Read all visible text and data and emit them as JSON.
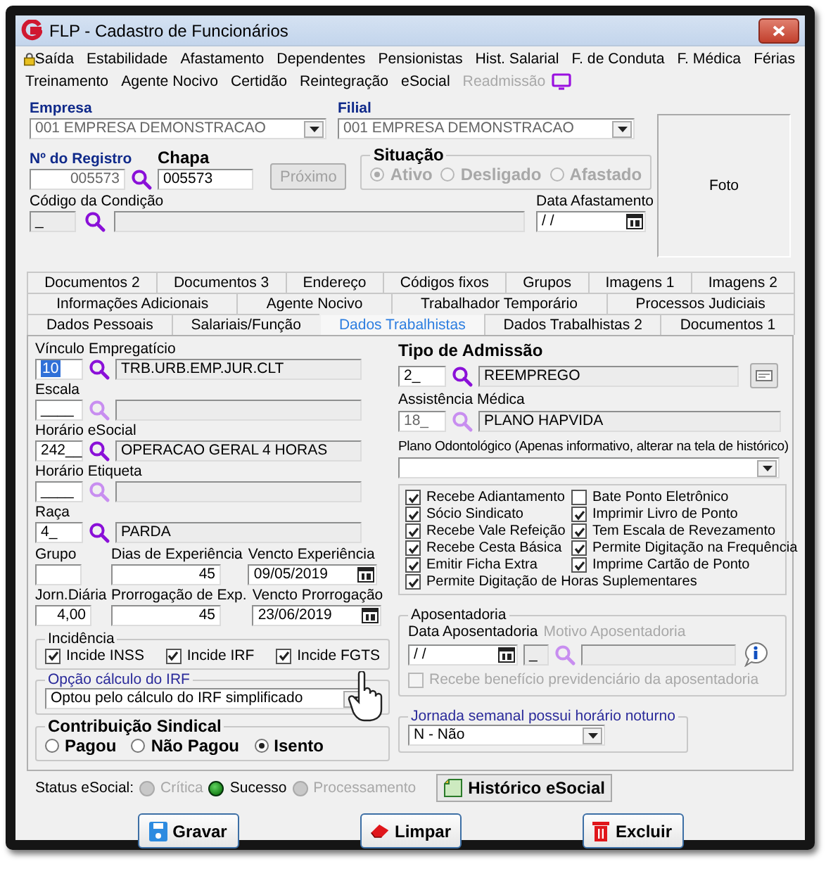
{
  "window": {
    "title": "FLP - Cadastro de Funcionários"
  },
  "menu_rows": [
    [
      {
        "label": "Saída",
        "disabled": false
      },
      {
        "label": "Estabilidade",
        "disabled": false
      },
      {
        "label": "Afastamento",
        "disabled": false
      },
      {
        "label": "Dependentes",
        "disabled": false
      },
      {
        "label": "Pensionistas",
        "disabled": false
      },
      {
        "label": "Hist. Salarial",
        "disabled": false
      },
      {
        "label": "F. de Conduta",
        "disabled": false
      },
      {
        "label": "F. Médica",
        "disabled": false
      },
      {
        "label": "Férias",
        "disabled": false
      }
    ],
    [
      {
        "label": "Treinamento",
        "disabled": false
      },
      {
        "label": "Agente Nocivo",
        "disabled": false
      },
      {
        "label": "Certidão",
        "disabled": false
      },
      {
        "label": "Reintegração",
        "disabled": false
      },
      {
        "label": "eSocial",
        "disabled": false
      },
      {
        "label": "Readmissão",
        "disabled": true
      }
    ]
  ],
  "empresa": {
    "label": "Empresa",
    "value": "001 EMPRESA DEMONSTRACAO"
  },
  "filial": {
    "label": "Filial",
    "value": "001 EMPRESA DEMONSTRACAO"
  },
  "registro": {
    "label": "Nº do Registro",
    "value": "005573"
  },
  "chapa": {
    "label": "Chapa",
    "value": "005573"
  },
  "next_button": {
    "label": "Próximo",
    "disabled": true
  },
  "situacao": {
    "title": "Situação",
    "options": [
      {
        "label": "Ativo",
        "selected": true
      },
      {
        "label": "Desligado",
        "selected": false
      },
      {
        "label": "Afastado",
        "selected": false
      }
    ]
  },
  "condicao": {
    "label": "Código da Condição",
    "code": "_"
  },
  "data_afastamento": {
    "label": "Data Afastamento",
    "value": "/ /"
  },
  "photo": {
    "label": "Foto"
  },
  "tabs": [
    [
      {
        "label": "Documentos 2",
        "selected": false
      },
      {
        "label": "Documentos 3",
        "selected": false
      },
      {
        "label": "Endereço",
        "selected": false
      },
      {
        "label": "Códigos fixos",
        "selected": false
      },
      {
        "label": "Grupos",
        "selected": false
      },
      {
        "label": "Imagens 1",
        "selected": false
      },
      {
        "label": "Imagens 2",
        "selected": false
      }
    ],
    [
      {
        "label": "Informações Adicionais",
        "selected": false
      },
      {
        "label": "Agente Nocivo",
        "selected": false
      },
      {
        "label": "Trabalhador Temporário",
        "selected": false
      },
      {
        "label": "Processos Judiciais",
        "selected": false
      }
    ],
    [
      {
        "label": "Dados Pessoais",
        "selected": false
      },
      {
        "label": "Salariais/Função",
        "selected": false
      },
      {
        "label": "Dados Trabalhistas",
        "selected": true
      },
      {
        "label": "Dados Trabalhistas 2",
        "selected": false
      },
      {
        "label": "Documentos 1",
        "selected": false
      }
    ]
  ],
  "lookups_left": [
    {
      "label": "Vínculo Empregatício",
      "code": "10",
      "code_selected": true,
      "description": "TRB.URB.EMP.JUR.CLT",
      "enabled": true
    },
    {
      "label": "Escala",
      "code": "____",
      "code_selected": false,
      "enabled": false
    },
    {
      "label": "Horário eSocial",
      "code": "242__",
      "code_selected": false,
      "description": "OPERACAO GERAL 4 HORAS",
      "enabled": true
    },
    {
      "label": "Horário Etiqueta",
      "code": "____",
      "code_selected": false,
      "enabled": false
    },
    {
      "label": "Raça",
      "code": "4_",
      "code_selected": false,
      "description": "PARDA",
      "enabled": true
    }
  ],
  "grupo": {
    "label": "Grupo"
  },
  "experience": [
    {
      "days_label": "Dias de Experiência",
      "days": "45",
      "date_label": "Vencto Experiência",
      "date": "09/05/2019"
    },
    {
      "days_label": "Prorrogação de Exp.",
      "days": "45",
      "date_label": "Vencto Prorrogação",
      "date": "23/06/2019"
    }
  ],
  "jornada_diaria": {
    "label": "Jorn.Diária",
    "value": "4,00"
  },
  "incidencia": {
    "title": "Incidência",
    "items": [
      {
        "label": "Incide INSS",
        "checked": true
      },
      {
        "label": "Incide IRF",
        "checked": true
      },
      {
        "label": "Incide FGTS",
        "checked": true
      }
    ]
  },
  "irf": {
    "title": "Opção cálculo do IRF",
    "value": "Optou pelo cálculo do IRF simplificado"
  },
  "contribuicao": {
    "title": "Contribuição Sindical",
    "options": [
      {
        "label": "Pagou",
        "selected": false
      },
      {
        "label": "Não Pagou",
        "selected": false
      },
      {
        "label": "Isento",
        "selected": true
      }
    ]
  },
  "tipo_admissao": {
    "label": "Tipo de Admissão",
    "code": "2_",
    "description": "REEMPREGO"
  },
  "assistencia": {
    "label": "Assistência Médica",
    "code": "18_",
    "description": "PLANO HAPVIDA"
  },
  "plano_odonto": {
    "label": "Plano Odontológico (Apenas informativo, alterar na tela de histórico)"
  },
  "benefits": [
    {
      "label": "Recebe Adiantamento",
      "checked": true
    },
    {
      "label": "Bate Ponto Eletrônico",
      "checked": false
    },
    {
      "label": "Sócio Sindicato",
      "checked": true
    },
    {
      "label": "Imprimir Livro de Ponto",
      "checked": true
    },
    {
      "label": "Recebe Vale Refeição",
      "checked": true
    },
    {
      "label": "Tem Escala de Revezamento",
      "checked": true
    },
    {
      "label": "Recebe Cesta Básica",
      "checked": true
    },
    {
      "label": "Permite Digitação na Frequência",
      "checked": true
    },
    {
      "label": "Emitir Ficha Extra",
      "checked": true
    },
    {
      "label": "Imprime Cartão de Ponto",
      "checked": true
    },
    {
      "label": "Permite Digitação de Horas Suplementares",
      "checked": true
    }
  ],
  "aposentadoria": {
    "title": "Aposentadoria",
    "date_label": "Data Aposentadoria",
    "date": "/ /",
    "reason_label": "Motivo Aposentadoria",
    "reason_disabled": true,
    "code": "_",
    "benefit": {
      "label": "Recebe benefício previdenciário da aposentadoria",
      "checked": false,
      "disabled": true
    }
  },
  "jornada_noturno": {
    "title": "Jornada semanal possui horário noturno",
    "value": "N - Não"
  },
  "status": {
    "label": "Status eSocial:",
    "options": [
      {
        "label": "Crítica",
        "selected": false
      },
      {
        "label": "Sucesso",
        "selected": true
      },
      {
        "label": "Processamento",
        "selected": false
      }
    ]
  },
  "history_button": {
    "label": "Histórico eSocial"
  },
  "buttons": [
    {
      "label": "Gravar",
      "kind": "save"
    },
    {
      "label": "Limpar",
      "kind": "clear"
    },
    {
      "label": "Excluir",
      "kind": "delete"
    }
  ]
}
